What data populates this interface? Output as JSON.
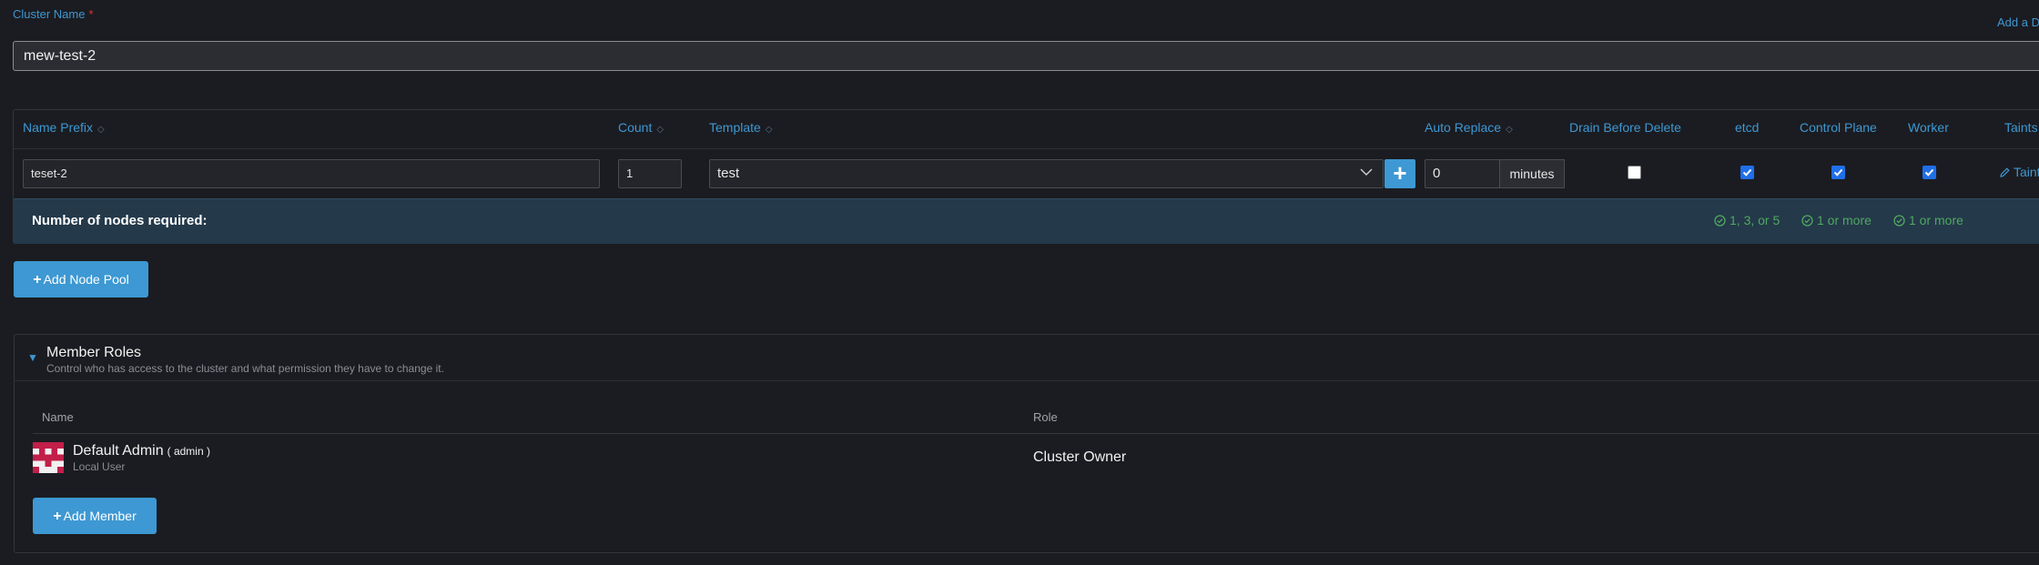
{
  "cluster": {
    "label": "Cluster Name",
    "required_mark": "*",
    "add_description": "Add a Description",
    "value": "mew-test-2"
  },
  "pool_table": {
    "headers": {
      "name_prefix": "Name Prefix",
      "count": "Count",
      "template": "Template",
      "auto_replace": "Auto Replace",
      "drain_before_delete": "Drain Before Delete",
      "etcd": "etcd",
      "control_plane": "Control Plane",
      "worker": "Worker",
      "taints": "Taints"
    },
    "row": {
      "name_prefix": "teset-2",
      "count": "1",
      "template": "test",
      "auto_replace": "0",
      "auto_replace_unit": "minutes",
      "drain_before_delete": false,
      "etcd": true,
      "control_plane": true,
      "worker": true,
      "taints_link": "Taints"
    },
    "required": {
      "label": "Number of nodes required:",
      "etcd": "1, 3, or 5",
      "control_plane": "1 or more",
      "worker": "1 or more"
    },
    "add_pool_label": "Add Node Pool"
  },
  "members": {
    "title": "Member Roles",
    "subtitle": "Control who has access to the cluster and what permission they have to change it.",
    "columns": {
      "name": "Name",
      "role": "Role"
    },
    "rows": [
      {
        "name": "Default Admin",
        "tag": "( admin )",
        "sub": "Local User",
        "role": "Cluster Owner"
      }
    ],
    "add_member_label": "Add Member"
  },
  "colors": {
    "accent": "#3d98d3",
    "success": "#4fa860",
    "background": "#1b1c21",
    "required_row": "#24394a",
    "avatar": "#c21f4a"
  },
  "icons": [
    "sort-icon",
    "chevron-down-icon",
    "plus-icon",
    "check-circle-icon",
    "pencil-icon",
    "caret-down-icon",
    "avatar-icon"
  ]
}
